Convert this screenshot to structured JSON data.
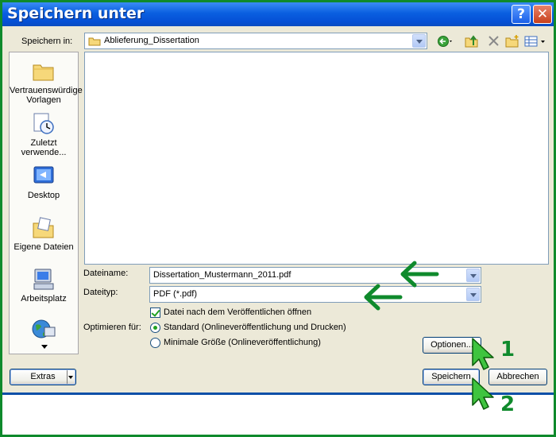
{
  "window": {
    "title": "Speichern unter",
    "help_label": "?",
    "close_label": "✕"
  },
  "location": {
    "label": "Speichern in:",
    "value": "Ablieferung_Dissertation"
  },
  "toolbar_icons": [
    "back-icon",
    "up-folder-icon",
    "delete-icon",
    "new-folder-icon",
    "view-menu-icon"
  ],
  "places": [
    {
      "label": "Vertrauenswürdige Vorlagen",
      "icon": "folder-icon"
    },
    {
      "label": "Zuletzt verwende...",
      "icon": "recent-documents-icon"
    },
    {
      "label": "Desktop",
      "icon": "desktop-icon"
    },
    {
      "label": "Eigene Dateien",
      "icon": "my-documents-icon"
    },
    {
      "label": "Arbeitsplatz",
      "icon": "my-computer-icon"
    },
    {
      "label": "",
      "icon": "network-icon"
    }
  ],
  "filename": {
    "label": "Dateiname:",
    "value": "Dissertation_Mustermann_2011.pdf"
  },
  "filetype": {
    "label": "Dateityp:",
    "value": "PDF (*.pdf)"
  },
  "open_after_publish": {
    "label": "Datei nach dem Veröffentlichen öffnen",
    "checked": true
  },
  "optimize": {
    "label": "Optimieren für:",
    "options": [
      {
        "label": "Standard (Onlineveröffentlichung und Drucken)",
        "selected": true
      },
      {
        "label": "Minimale Größe (Onlineveröffentlichung)",
        "selected": false
      }
    ]
  },
  "buttons": {
    "options": "Optionen...",
    "tools": "Extras",
    "save": "Speichern",
    "cancel": "Abbrechen"
  },
  "annotations": {
    "step1": "1",
    "step2": "2",
    "color": "#0f8a2c"
  },
  "colors": {
    "titlebar": "#0a5fe0",
    "dialog_bg": "#ece9d8",
    "frame": "#0f8a2c"
  }
}
